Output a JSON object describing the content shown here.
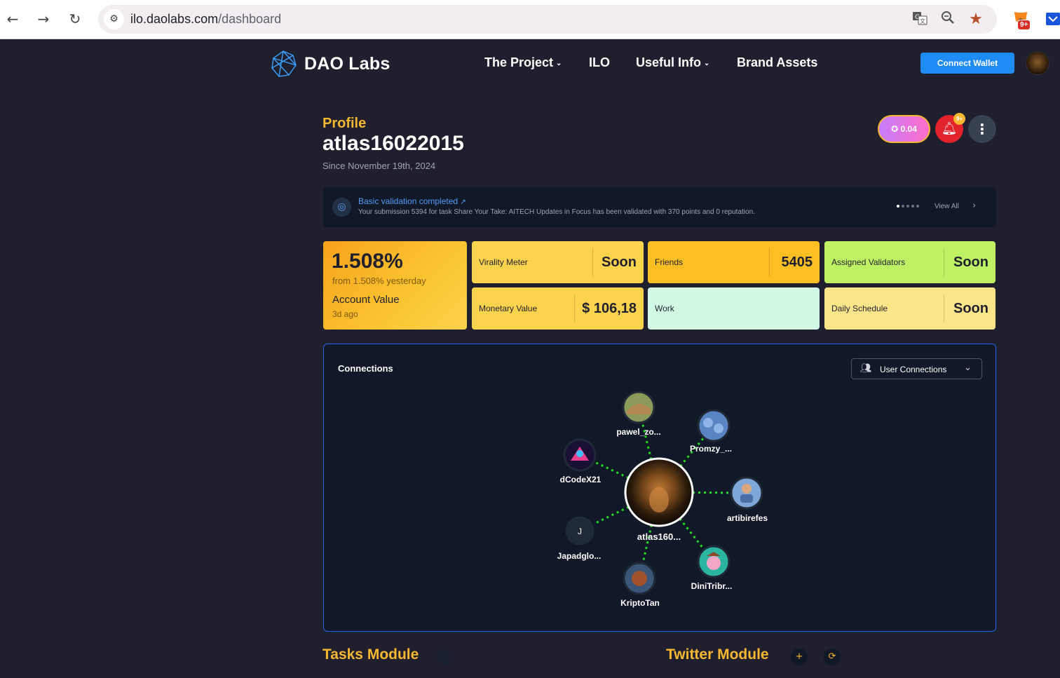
{
  "browser": {
    "url_host": "ilo.daolabs.com",
    "url_path": "/dashboard",
    "extension_badge": "9+"
  },
  "header": {
    "brand": "DAO Labs",
    "nav": [
      {
        "label": "The Project",
        "has_dropdown": true
      },
      {
        "label": "ILO",
        "has_dropdown": false
      },
      {
        "label": "Useful Info",
        "has_dropdown": true
      },
      {
        "label": "Brand Assets",
        "has_dropdown": false
      }
    ],
    "connect_label": "Connect Wallet"
  },
  "profile": {
    "label": "Profile",
    "username": "atlas16022015",
    "since": "Since November 19th, 2024",
    "points": "0.04",
    "notification_badge": "9+"
  },
  "notification": {
    "title": "Basic validation completed",
    "body": "Your submission 5394 for task Share Your Take: AITECH Updates in Focus has been validated with 370 points and 0 reputation.",
    "view_all": "View All",
    "page_count": 5,
    "active_page": 0
  },
  "stats": {
    "account_value": {
      "value": "1.508%",
      "sub": "from 1.508% yesterday",
      "label": "Account Value",
      "ago": "3d ago"
    },
    "virality": {
      "label": "Virality Meter",
      "value": "Soon"
    },
    "friends": {
      "label": "Friends",
      "value": "5405"
    },
    "validators": {
      "label": "Assigned Validators",
      "value": "Soon"
    },
    "monetary": {
      "label": "Monetary Value",
      "value": "$ 106,18"
    },
    "work": {
      "label": "Work",
      "value": ""
    },
    "schedule": {
      "label": "Daily Schedule",
      "value": "Soon"
    }
  },
  "connections": {
    "title": "Connections",
    "filter_label": "User Connections",
    "center": {
      "name": "atlas160..."
    },
    "nodes": [
      {
        "name": "pawel_zo...",
        "initial": ""
      },
      {
        "name": "Promzy_...",
        "initial": ""
      },
      {
        "name": "dCodeX21",
        "initial": ""
      },
      {
        "name": "artibirefes",
        "initial": ""
      },
      {
        "name": "Japadglo...",
        "initial": "J"
      },
      {
        "name": "DiniTribr...",
        "initial": ""
      },
      {
        "name": "KriptoTan",
        "initial": ""
      }
    ]
  },
  "modules": {
    "tasks_title": "Tasks Module",
    "twitter_title": "Twitter Module"
  },
  "colors": {
    "accent": "#f7b731",
    "primary": "#1f8cf5",
    "page_bg": "#1f1f2e",
    "panel_bg": "#111827",
    "edge": "#22dd22"
  }
}
